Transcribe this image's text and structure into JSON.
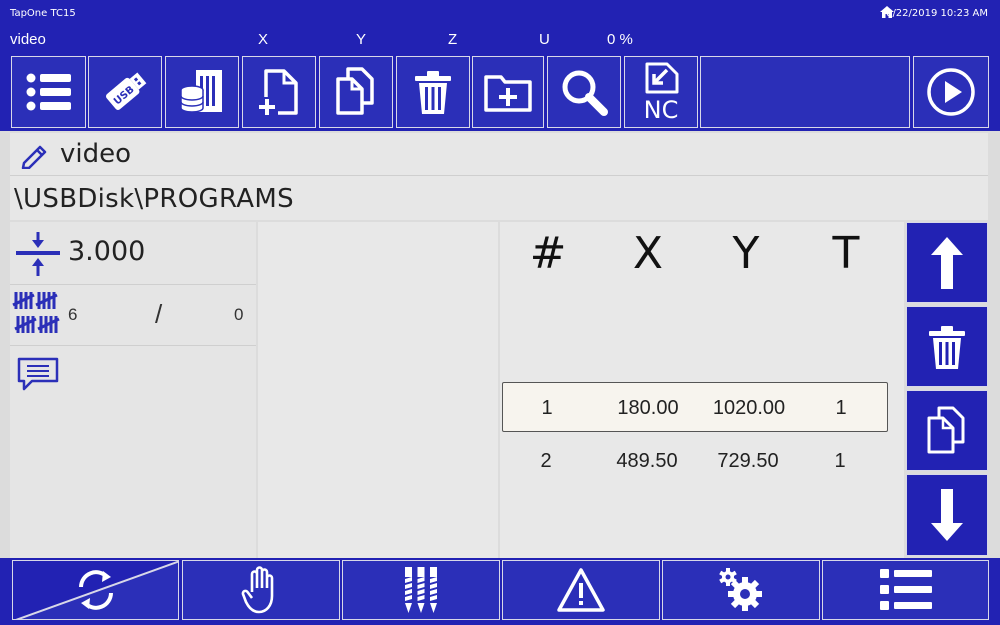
{
  "title_bar": {
    "app_name": "TapOne TC15",
    "datetime": "8/22/2019 10:23 AM"
  },
  "status_bar": {
    "program": "video",
    "x_label": "X",
    "y_label": "Y",
    "z_label": "Z",
    "u_label": "U",
    "progress": "0 %"
  },
  "toolbar": {
    "buttons": [
      {
        "icon": "list-icon"
      },
      {
        "icon": "usb-drive-icon",
        "label": "USB"
      },
      {
        "icon": "server-database-icon"
      },
      {
        "icon": "new-file-icon"
      },
      {
        "icon": "copy-files-icon"
      },
      {
        "icon": "trash-icon"
      },
      {
        "icon": "new-folder-icon"
      },
      {
        "icon": "search-icon"
      },
      {
        "icon": "nc-import-icon",
        "label": "NC"
      },
      {
        "icon": "play-icon"
      }
    ]
  },
  "program_name": "video",
  "path": "\\USBDisk\\PROGRAMS",
  "thickness": "3.000",
  "counter": {
    "done": "6",
    "separator": "/",
    "total": "0"
  },
  "table": {
    "columns": [
      "#",
      "X",
      "Y",
      "T"
    ],
    "rows": [
      {
        "n": "1",
        "x": "180.00",
        "y": "1020.00",
        "t": "1",
        "selected": true
      },
      {
        "n": "2",
        "x": "489.50",
        "y": "729.50",
        "t": "1",
        "selected": false
      }
    ]
  },
  "side_buttons": [
    "arrow-up-icon",
    "trash-icon",
    "copy-icon",
    "arrow-down-icon"
  ],
  "bottom_buttons": [
    "mode-cycle-icon",
    "hand-icon",
    "tools-icon",
    "warning-icon",
    "settings-icon",
    "menu-list-icon"
  ],
  "colors": {
    "primary": "#2222b3",
    "panel": "#e6e6e6",
    "selected_row": "#f7f4ee"
  }
}
